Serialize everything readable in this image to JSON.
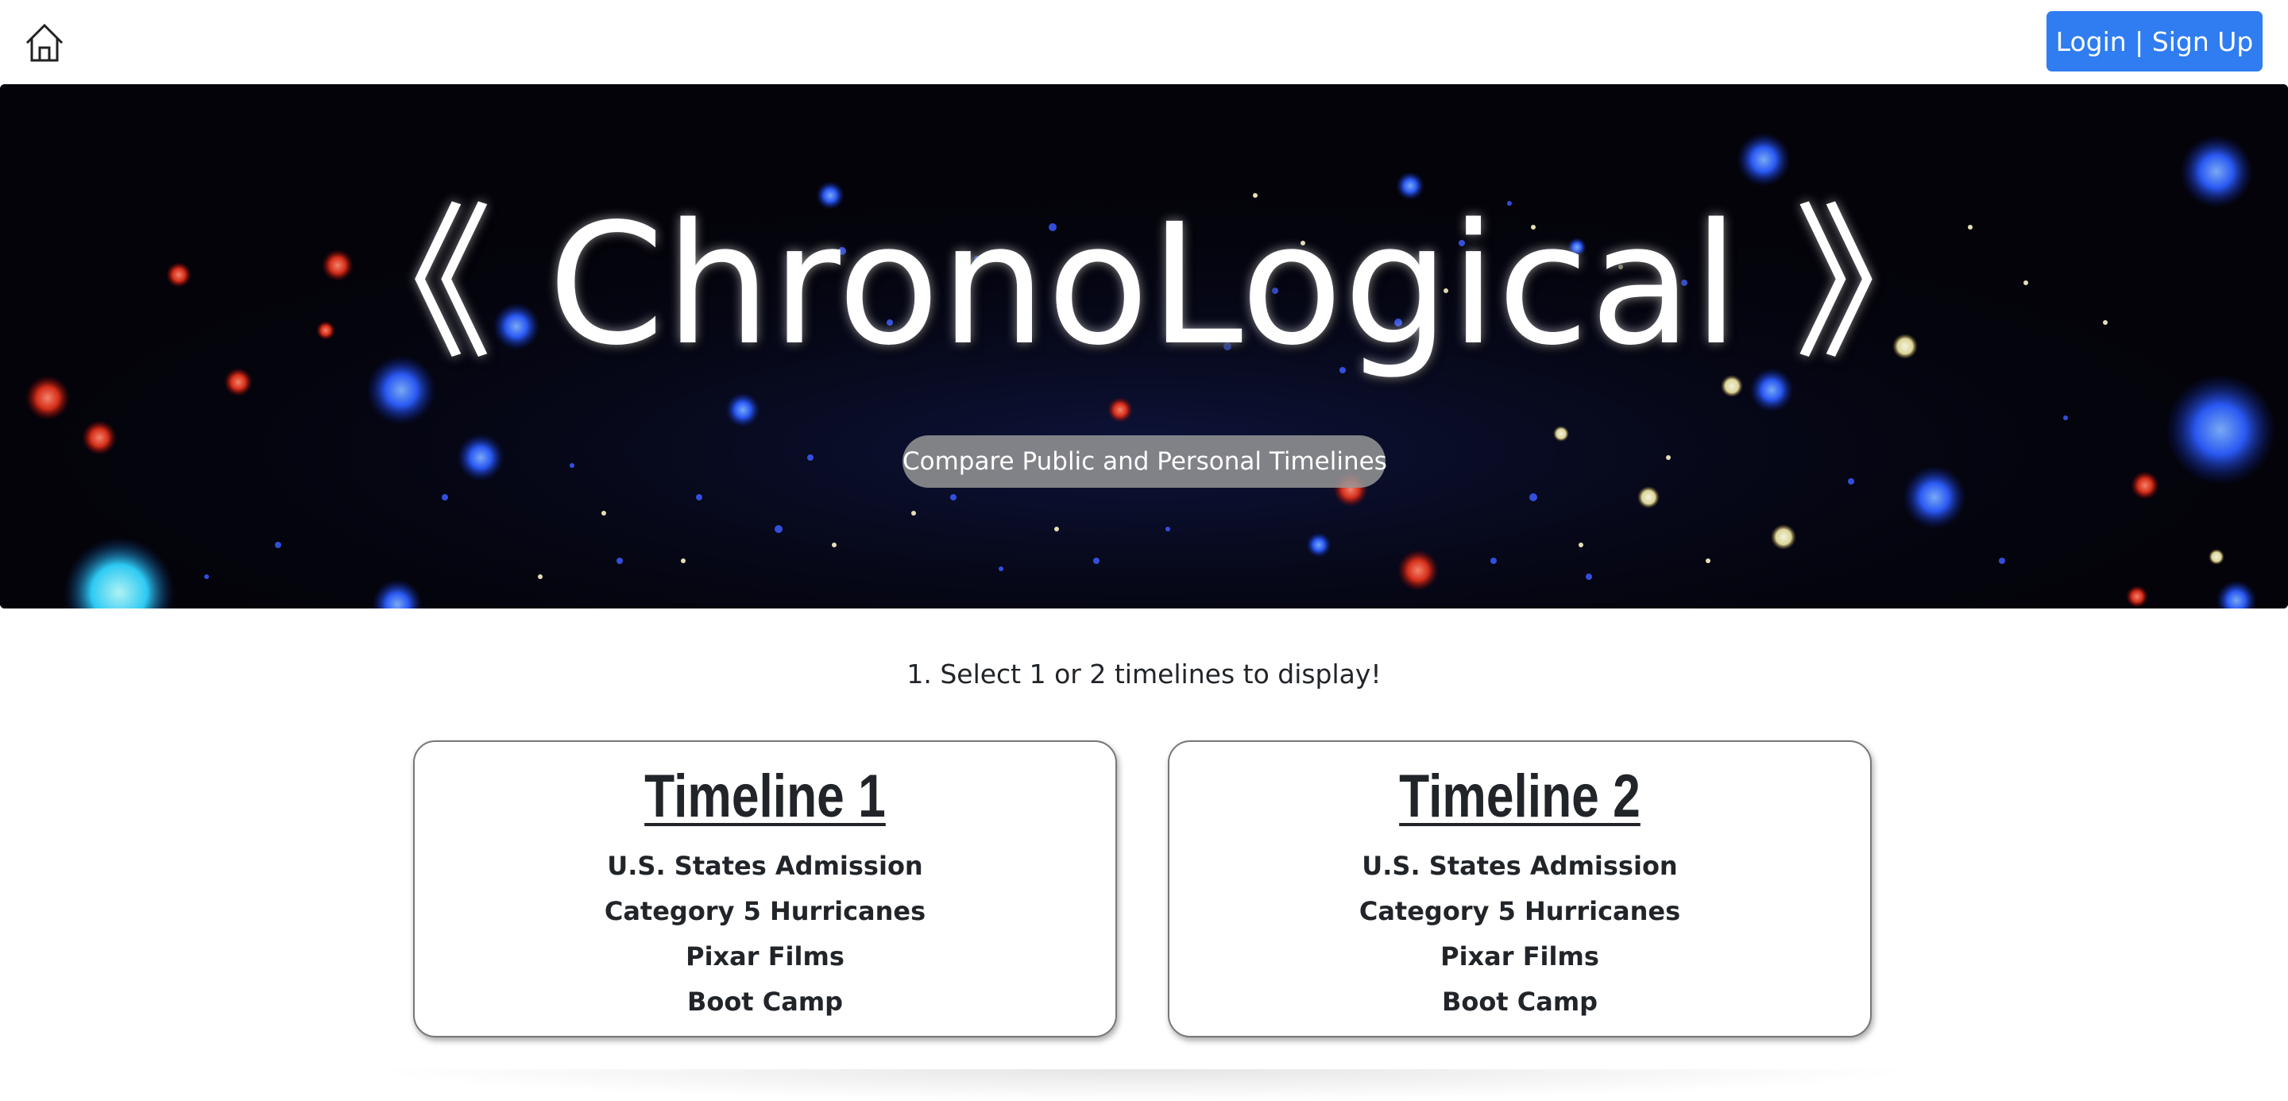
{
  "header": {
    "home_icon": "home-icon",
    "login_label": "Login | Sign Up",
    "login_color": "#2f7df0"
  },
  "hero": {
    "title": "《 ChronoLogical 》",
    "subtitle": "Compare Public and Personal Timelines"
  },
  "main": {
    "instruction": "1. Select 1 or 2 timelines to display!",
    "timelines": [
      {
        "title": "Timeline 1",
        "options": [
          "U.S. States Admission",
          "Category 5 Hurricanes",
          "Pixar Films",
          "Boot Camp"
        ]
      },
      {
        "title": "Timeline 2",
        "options": [
          "U.S. States Admission",
          "Category 5 Hurricanes",
          "Pixar Films",
          "Boot Camp"
        ]
      }
    ]
  }
}
